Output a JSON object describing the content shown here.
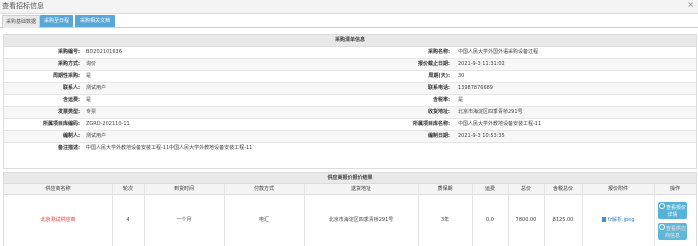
{
  "window": {
    "title": "查看招标信息",
    "close_glyph": "×"
  },
  "tabs": [
    {
      "label": "采购基础数据"
    },
    {
      "label": "采购至日程"
    },
    {
      "label": "采购相关文档"
    }
  ],
  "procurement": {
    "header": "采购清单信息",
    "rows": [
      {
        "l1": "采购编号:",
        "v1": "BD202101636",
        "l2": "采购名称:",
        "v2": "中国人民大学外国外语采购设备过程"
      },
      {
        "l1": "采购方式:",
        "v1": "询价",
        "l2": "报价截止日期:",
        "v2": "2021-9-3 11:31:02"
      },
      {
        "l1": "周期性采购:",
        "v1": "是",
        "l2": "周期(天):",
        "v2": "30"
      },
      {
        "l1": "联系人:",
        "v1": "测试用户",
        "l2": "联系电话:",
        "v2": "13987876689"
      },
      {
        "l1": "含运费:",
        "v1": "是",
        "l2": "含税率:",
        "v2": "是"
      },
      {
        "l1": "发票类型:",
        "v1": "专票",
        "l2": "收货地址:",
        "v2": "北京市海淀区四季青桥291号"
      },
      {
        "l1": "所属项目库编码:",
        "v1": "ZGRD-202110-11",
        "l2": "所属项目库名称:",
        "v2": "中国人民大学外教地设备安装工程-11"
      },
      {
        "l1": "编制人:",
        "v1": "测试用户",
        "l2": "编制日期:",
        "v2": "2021-9-3 10:53:35"
      }
    ],
    "remark_label": "备注描述:",
    "remark_value": "中国人民大学外教地设备安装工程-11中国人民大学外教地设备安装工程-11"
  },
  "quotes": {
    "header": "供应商报价报价结果",
    "columns": [
      "供应商名称",
      "轮次",
      "到货时间",
      "付款方式",
      "送货地址",
      "质保期",
      "运费",
      "总价",
      "含税总价",
      "报价附件",
      "操作"
    ],
    "rows": [
      {
        "supplier": "北京测试供应商",
        "round": "4",
        "delivery": "一个月",
        "payment": "电汇",
        "address": "北京市海淀区四季青桥291号",
        "warranty": "3年",
        "freight": "0.0",
        "total": "7800.00",
        "total_tax": "8125.00",
        "attachment": "fz解析.jpeg",
        "actions": [
          "查看报价详情",
          "查看供应商信息"
        ]
      }
    ]
  }
}
